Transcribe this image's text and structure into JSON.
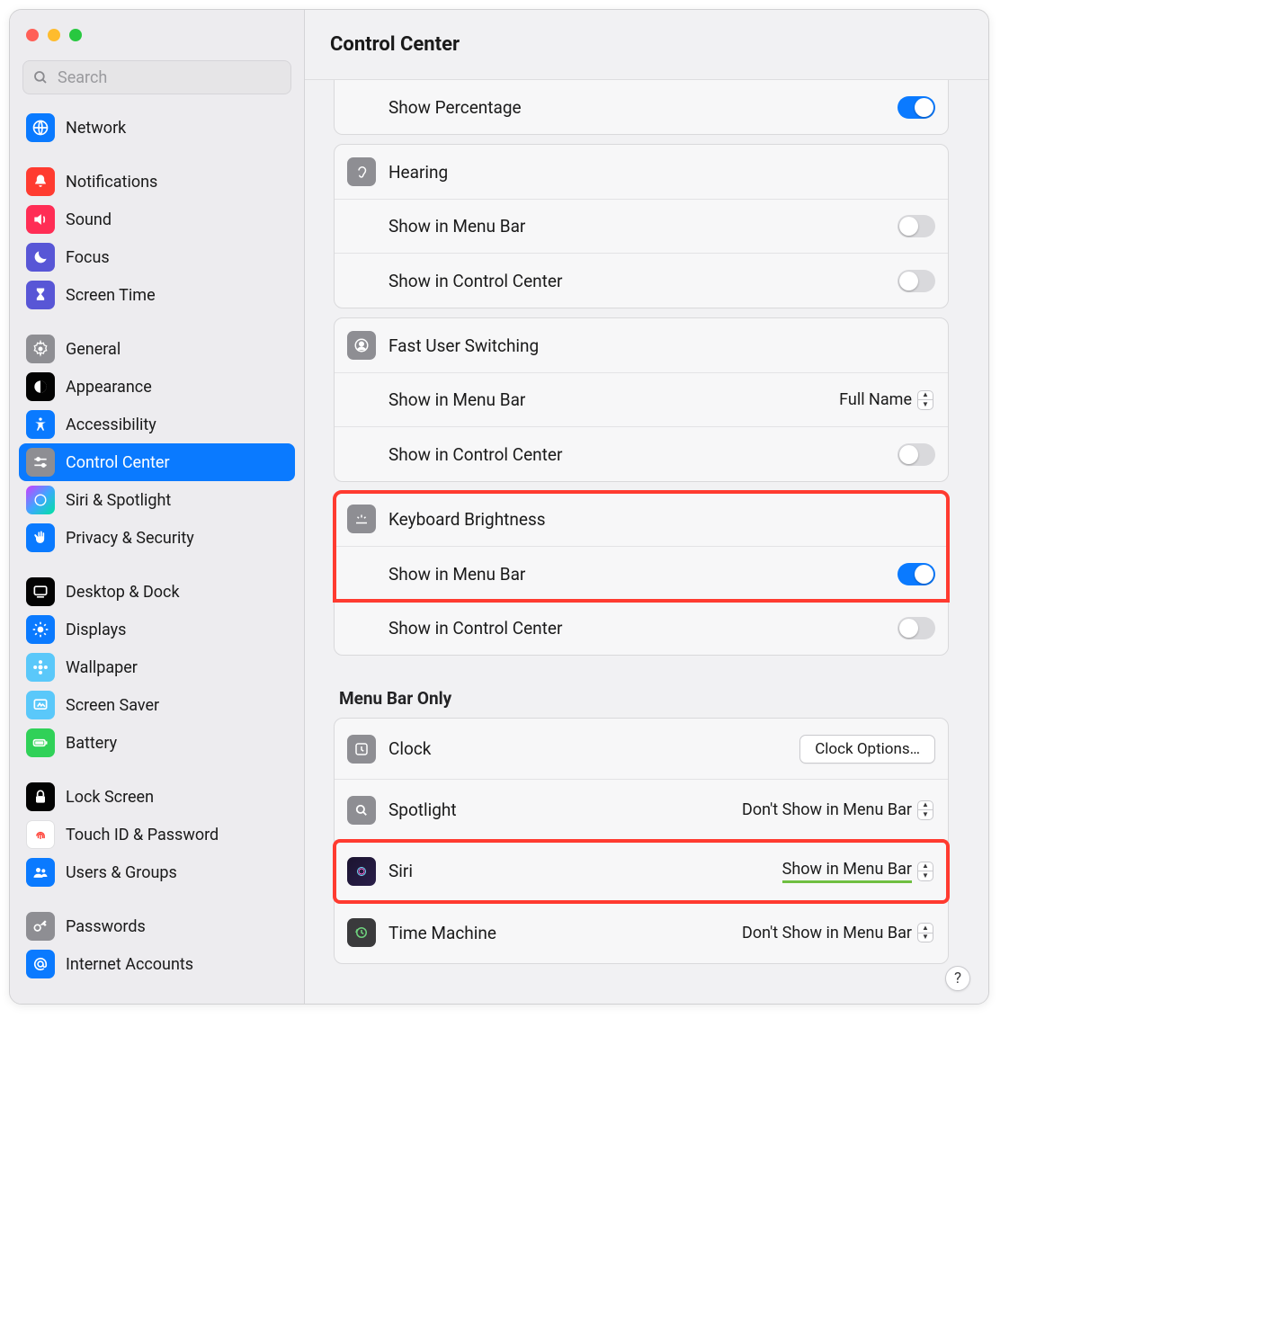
{
  "app": {
    "title": "Control Center"
  },
  "search": {
    "placeholder": "Search"
  },
  "sidebar": {
    "items": [
      {
        "label": "Network"
      },
      {
        "label": "Notifications"
      },
      {
        "label": "Sound"
      },
      {
        "label": "Focus"
      },
      {
        "label": "Screen Time"
      },
      {
        "label": "General"
      },
      {
        "label": "Appearance"
      },
      {
        "label": "Accessibility"
      },
      {
        "label": "Control Center"
      },
      {
        "label": "Siri & Spotlight"
      },
      {
        "label": "Privacy & Security"
      },
      {
        "label": "Desktop & Dock"
      },
      {
        "label": "Displays"
      },
      {
        "label": "Wallpaper"
      },
      {
        "label": "Screen Saver"
      },
      {
        "label": "Battery"
      },
      {
        "label": "Lock Screen"
      },
      {
        "label": "Touch ID & Password"
      },
      {
        "label": "Users & Groups"
      },
      {
        "label": "Passwords"
      },
      {
        "label": "Internet Accounts"
      }
    ]
  },
  "content": {
    "battery": {
      "show_percentage_label": "Show Percentage",
      "show_percentage_on": true
    },
    "hearing": {
      "title": "Hearing",
      "menu_label": "Show in Menu Bar",
      "menu_on": false,
      "cc_label": "Show in Control Center",
      "cc_on": false
    },
    "fast_user": {
      "title": "Fast User Switching",
      "menu_label": "Show in Menu Bar",
      "menu_value": "Full Name",
      "cc_label": "Show in Control Center",
      "cc_on": false
    },
    "keyboard": {
      "title": "Keyboard Brightness",
      "menu_label": "Show in Menu Bar",
      "menu_on": true,
      "cc_label": "Show in Control Center",
      "cc_on": false
    },
    "menu_only": {
      "heading": "Menu Bar Only",
      "clock": {
        "title": "Clock",
        "button": "Clock Options…"
      },
      "spotlight": {
        "title": "Spotlight",
        "value": "Don't Show in Menu Bar"
      },
      "siri": {
        "title": "Siri",
        "value": "Show in Menu Bar"
      },
      "time_machine": {
        "title": "Time Machine",
        "value": "Don't Show in Menu Bar"
      }
    }
  },
  "help_label": "?"
}
